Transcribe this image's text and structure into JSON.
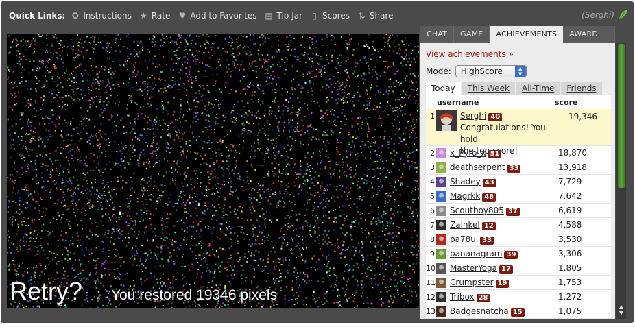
{
  "quick_links": {
    "label": "Quick Links:",
    "items": [
      {
        "label": "Instructions",
        "icon": "help-icon"
      },
      {
        "label": "Rate",
        "icon": "star-icon"
      },
      {
        "label": "Add to Favorites",
        "icon": "heart-icon"
      },
      {
        "label": "Tip Jar",
        "icon": "jar-icon"
      },
      {
        "label": "Scores",
        "icon": "scores-icon"
      },
      {
        "label": "Share",
        "icon": "share-icon"
      }
    ]
  },
  "user_tag": "(Serghi)",
  "game": {
    "message": "You restored 19346 pixels",
    "retry": "Retry?"
  },
  "tabs": [
    "CHAT",
    "GAME",
    "ACHIEVEMENTS",
    "AWARD"
  ],
  "active_tab": "ACHIEVEMENTS",
  "panel": {
    "view_link": "View achievements »",
    "mode_label": "Mode:",
    "mode_value": "HighScore",
    "subtabs": [
      "Today",
      "This Week",
      "All-Time",
      "Friends"
    ],
    "columns": {
      "user": "username",
      "score": "score"
    },
    "first_message_line1": "Congratulations! You hold",
    "first_message_line2": "the top score!",
    "rows": [
      {
        "rank": "1",
        "user": "Serghi",
        "level": "40",
        "score": "19,346"
      },
      {
        "rank": "2",
        "user": "x_Pyro_x",
        "level": "51",
        "score": "18,870"
      },
      {
        "rank": "3",
        "user": "deathserpent",
        "level": "33",
        "score": "13,918"
      },
      {
        "rank": "4",
        "user": "Shadey",
        "level": "43",
        "score": "7,729"
      },
      {
        "rank": "5",
        "user": "Magrkk",
        "level": "48",
        "score": "7,642"
      },
      {
        "rank": "6",
        "user": "Scoutboy805",
        "level": "37",
        "score": "6,619"
      },
      {
        "rank": "7",
        "user": "Zainkel",
        "level": "12",
        "score": "4,588"
      },
      {
        "rank": "8",
        "user": "pa78ul",
        "level": "33",
        "score": "3,530"
      },
      {
        "rank": "9",
        "user": "bananagram",
        "level": "39",
        "score": "3,306"
      },
      {
        "rank": "10",
        "user": "MasterYoga",
        "level": "17",
        "score": "1,805"
      },
      {
        "rank": "11",
        "user": "Crumpster",
        "level": "19",
        "score": "1,753"
      },
      {
        "rank": "12",
        "user": "Tribox",
        "level": "28",
        "score": "1,272"
      },
      {
        "rank": "13",
        "user": "Badgesnatcha",
        "level": "15",
        "score": "1,075"
      }
    ]
  },
  "colors": {
    "frame": "#4a4a4a",
    "link_red": "#9b1c1c",
    "level_badge": "#7a1c10",
    "highlight_row": "#fcf8cc",
    "scroll_green": "#5aa83a"
  }
}
